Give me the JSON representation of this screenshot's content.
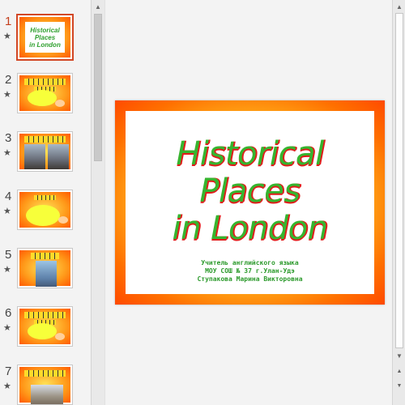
{
  "slides": [
    {
      "number": "1",
      "star": "★"
    },
    {
      "number": "2",
      "star": "★"
    },
    {
      "number": "3",
      "star": "★"
    },
    {
      "number": "4",
      "star": "★"
    },
    {
      "number": "5",
      "star": "★"
    },
    {
      "number": "6",
      "star": "★"
    },
    {
      "number": "7",
      "star": "★"
    }
  ],
  "thumb1": {
    "title_line1": "Historical Places",
    "title_line2": "in London"
  },
  "current_slide": {
    "title_line1": "Historical Places",
    "title_line2": "in London",
    "subtitle_line1": "Учитель английского языка",
    "subtitle_line2": "МОУ СОШ № 37 г.Улан-Удэ",
    "subtitle_line3": "Ступакова Марина Викторовна"
  },
  "scroll": {
    "up": "▲",
    "down": "▼",
    "prev_slide": "▲",
    "next_slide": "▼"
  },
  "colors": {
    "accent": "#d24726",
    "title_green": "#36b52f",
    "title_red_shadow": "#e11b1b",
    "frame_orange": "#ff7000"
  }
}
